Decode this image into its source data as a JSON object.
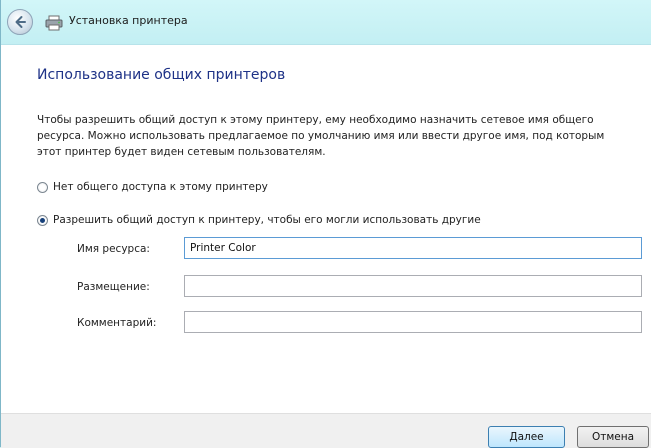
{
  "window": {
    "title": "Установка принтера"
  },
  "page": {
    "heading": "Использование общих принтеров",
    "description": "Чтобы разрешить общий доступ к этому принтеру, ему необходимо назначить сетевое имя общего ресурса. Можно использовать предлагаемое по умолчанию имя или ввести другое имя, под которым этот принтер будет виден сетевым пользователям."
  },
  "sharing_options": [
    {
      "label": "Нет общего доступа к этому принтеру",
      "selected": false
    },
    {
      "label": "Разрешить общий доступ к принтеру, чтобы его могли использовать другие",
      "selected": true
    }
  ],
  "fields": {
    "share_name": {
      "label": "Имя ресурса:",
      "value": "Printer Color"
    },
    "location": {
      "label": "Размещение:",
      "value": ""
    },
    "comment": {
      "label": "Комментарий:",
      "value": ""
    }
  },
  "buttons": {
    "next": "Далее",
    "cancel": "Отмена"
  }
}
